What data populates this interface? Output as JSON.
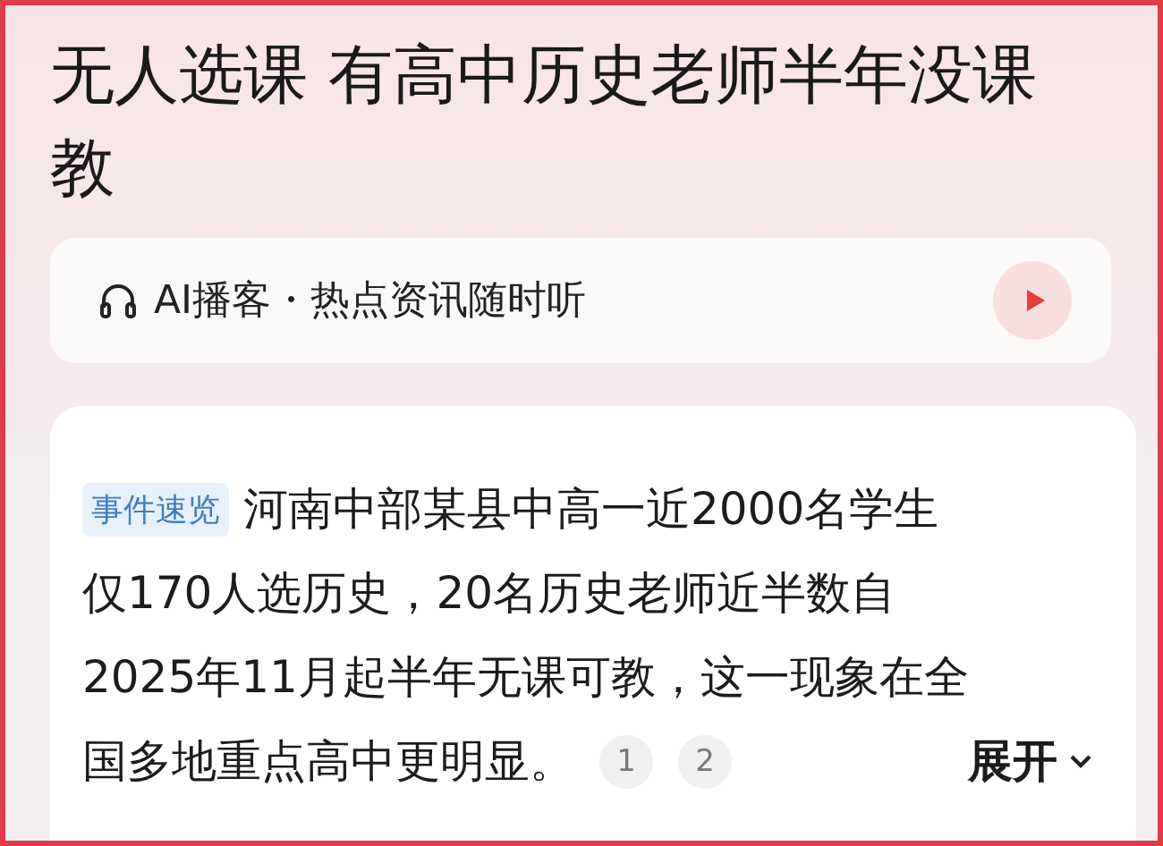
{
  "headline": "无人选课 有高中历史老师半年没课教",
  "podcast_bar": {
    "label": "AI播客・热点资讯随时听"
  },
  "summary": {
    "tag": "事件速览",
    "lines": [
      "河南中部某县中高一近2000名学生",
      "仅170人选历史，20名历史老师近半数自",
      "2025年11月起半年无课可教，这一现象在全",
      "国多地重点高中更明显。"
    ],
    "citations": [
      "1",
      "2"
    ],
    "expand": "展开"
  }
}
